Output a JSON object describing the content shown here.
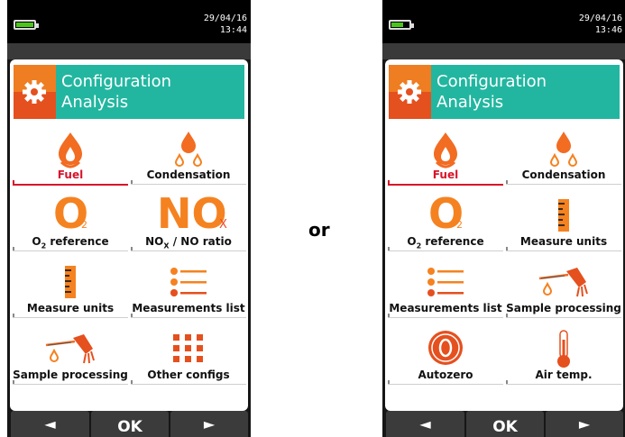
{
  "separator": "or",
  "left_screen": {
    "date": "29/04/16",
    "time": "13:44",
    "battery_level": 0.85,
    "header": {
      "line1": "Configuration",
      "line2": "Analysis"
    },
    "tiles": [
      {
        "label": "Fuel",
        "icon": "fuel-drop-icon",
        "selected": true
      },
      {
        "label": "Condensation",
        "icon": "condensation-drops-icon",
        "selected": false
      },
      {
        "label_main": "O",
        "label_sub": "2",
        "label_rest": " reference",
        "icon_text": "O",
        "icon_sub": "2",
        "icon": "o2-icon"
      },
      {
        "label_main": "NO",
        "label_sub": "X",
        "label_rest": " / NO ratio",
        "icon_text": "NO",
        "icon_sub": "X",
        "icon": "nox-icon"
      },
      {
        "label": "Measure units",
        "icon": "ruler-icon"
      },
      {
        "label": "Measurements list",
        "icon": "list-icon"
      },
      {
        "label": "Sample processing",
        "icon": "probe-icon"
      },
      {
        "label": "Other configs",
        "icon": "grid-icon"
      }
    ],
    "nav": {
      "left": "◄",
      "ok": "OK",
      "right": "►"
    }
  },
  "right_screen": {
    "date": "29/04/16",
    "time": "13:46",
    "battery_level": 0.6,
    "header": {
      "line1": "Configuration",
      "line2": "Analysis"
    },
    "tiles": [
      {
        "label": "Fuel",
        "icon": "fuel-drop-icon",
        "selected": true
      },
      {
        "label": "Condensation",
        "icon": "condensation-drops-icon",
        "selected": false
      },
      {
        "label_main": "O",
        "label_sub": "2",
        "label_rest": " reference",
        "icon_text": "O",
        "icon_sub": "2",
        "icon": "o2-icon"
      },
      {
        "label": "Measure units",
        "icon": "ruler-icon"
      },
      {
        "label": "Measurements list",
        "icon": "list-icon"
      },
      {
        "label": "Sample processing",
        "icon": "probe-icon"
      },
      {
        "label": "Autozero",
        "icon": "autozero-icon"
      },
      {
        "label": "Air temp.",
        "icon": "thermometer-icon"
      }
    ],
    "nav": {
      "left": "◄",
      "ok": "OK",
      "right": "►"
    }
  },
  "colors": {
    "accent_orange": "#f58220",
    "accent_red": "#e5501f",
    "header_teal": "#22b6a0",
    "selected_red": "#d8142a",
    "battery_green": "#4cc51a"
  }
}
